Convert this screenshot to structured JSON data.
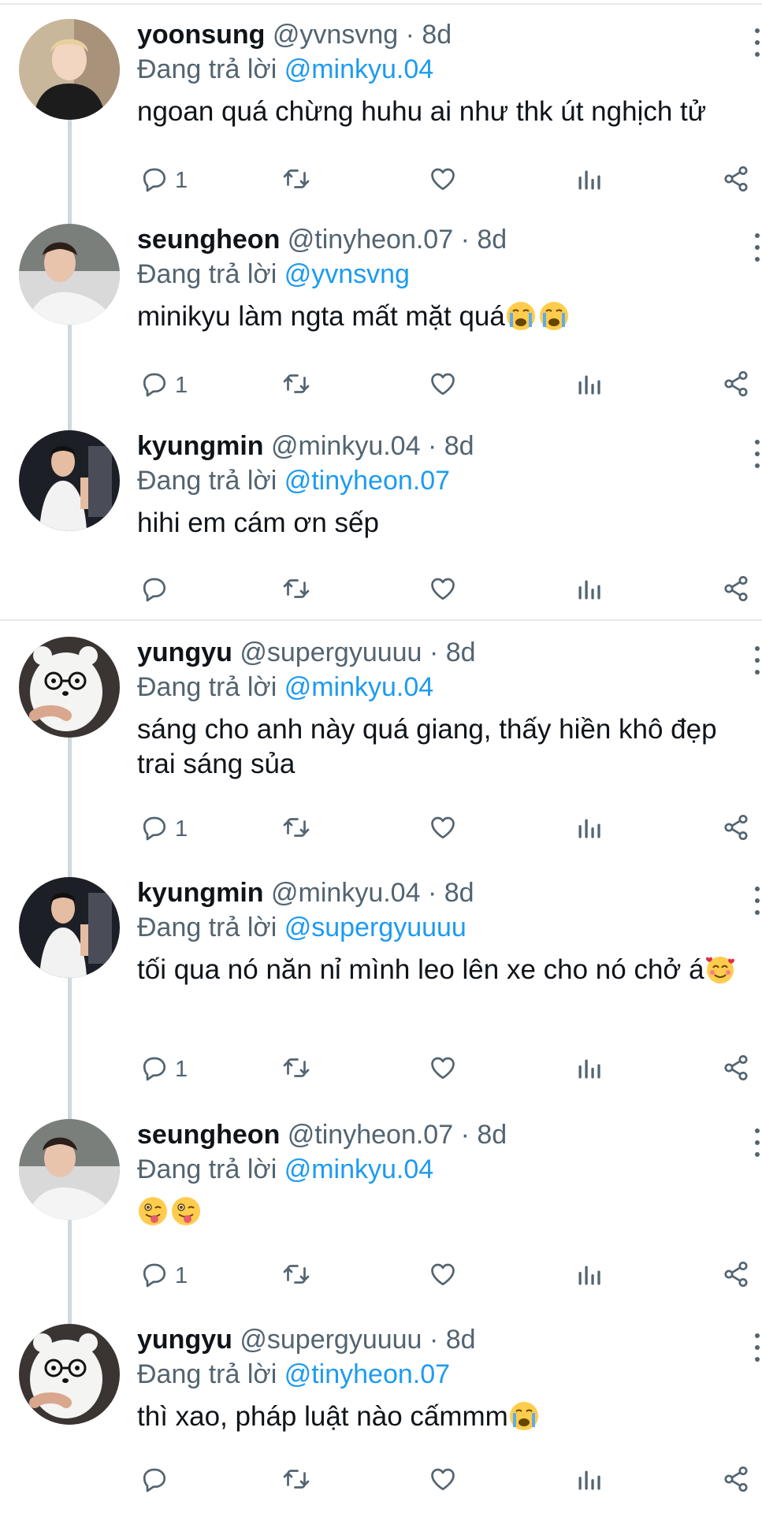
{
  "colors": {
    "accent": "#1d9bf0",
    "text": "#0f1419",
    "muted": "#536471",
    "divider": "#e7e9ea",
    "thread_line": "#cfd9de"
  },
  "replying_prefix": "Đang trả lời",
  "dot": "·",
  "tweets": [
    {
      "name": "yoonsung",
      "handle": "@yvnsvng",
      "time": "8d",
      "reply_to": "@minkyu.04",
      "text": "ngoan quá chừng huhu ai như thk út nghịch tử",
      "emojis": [],
      "reply_count": "1"
    },
    {
      "name": "seungheon",
      "handle": "@tinyheon.07",
      "time": "8d",
      "reply_to": "@yvnsvng",
      "text": "minikyu làm ngta mất mặt quá",
      "emojis": [
        "loudly-crying-face",
        "loudly-crying-face"
      ],
      "reply_count": "1"
    },
    {
      "name": "kyungmin",
      "handle": "@minkyu.04",
      "time": "8d",
      "reply_to": "@tinyheon.07",
      "text": "hihi em cám ơn sếp",
      "emojis": [],
      "reply_count": ""
    },
    {
      "name": "yungyu",
      "handle": "@supergyuuuu",
      "time": "8d",
      "reply_to": "@minkyu.04",
      "text": "sáng cho anh này quá giang, thấy hiền khô đẹp trai sáng sủa",
      "emojis": [],
      "reply_count": "1"
    },
    {
      "name": "kyungmin",
      "handle": "@minkyu.04",
      "time": "8d",
      "reply_to": "@supergyuuuu",
      "text": "tối qua nó năn nỉ mình leo lên xe cho nó chở á",
      "emojis": [
        "smiling-face-with-hearts"
      ],
      "reply_count": "1"
    },
    {
      "name": "seungheon",
      "handle": "@tinyheon.07",
      "time": "8d",
      "reply_to": "@minkyu.04",
      "text": "",
      "emojis": [
        "winking-face-with-tongue",
        "winking-face-with-tongue"
      ],
      "reply_count": "1"
    },
    {
      "name": "yungyu",
      "handle": "@supergyuuuu",
      "time": "8d",
      "reply_to": "@tinyheon.07",
      "text": "thì xao, pháp luật nào cấmmm",
      "emojis": [
        "loudly-crying-face"
      ],
      "reply_count": ""
    }
  ],
  "icons": {
    "reply": "reply-icon",
    "retweet": "retweet-icon",
    "like": "heart-icon",
    "views": "views-icon",
    "share": "share-icon",
    "more": "more-icon"
  }
}
